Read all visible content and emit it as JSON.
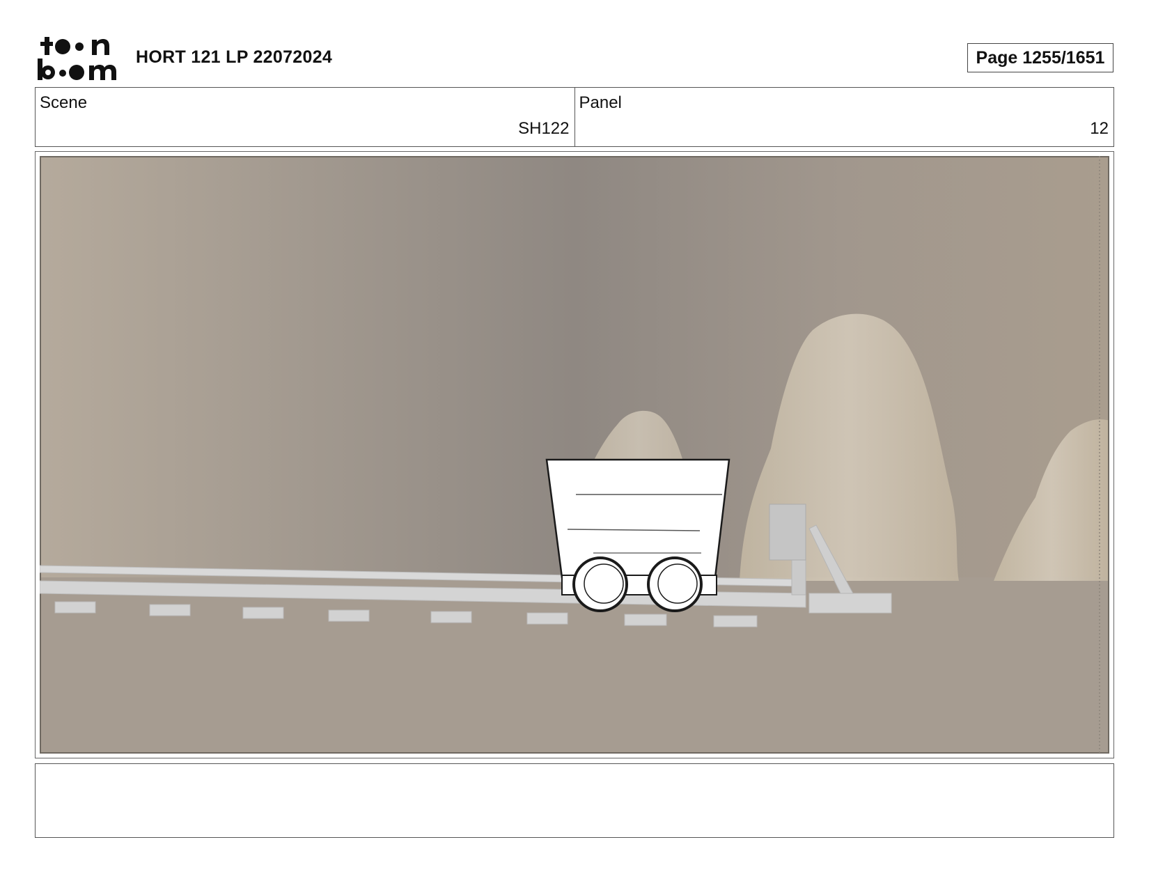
{
  "header": {
    "logo": "toon boom",
    "title": "HORT 121 LP 22072024",
    "page": "Page 1255/1651"
  },
  "scene": {
    "label": "Scene",
    "value": "SH122"
  },
  "panel": {
    "label": "Panel",
    "value": "12"
  },
  "notes": {
    "text": ""
  },
  "colors": {
    "background": "#a59b91",
    "rock": "#d8cebd",
    "rail": "#d4d4d4",
    "cart": "#ffffff",
    "outline": "#1a1a1a"
  }
}
